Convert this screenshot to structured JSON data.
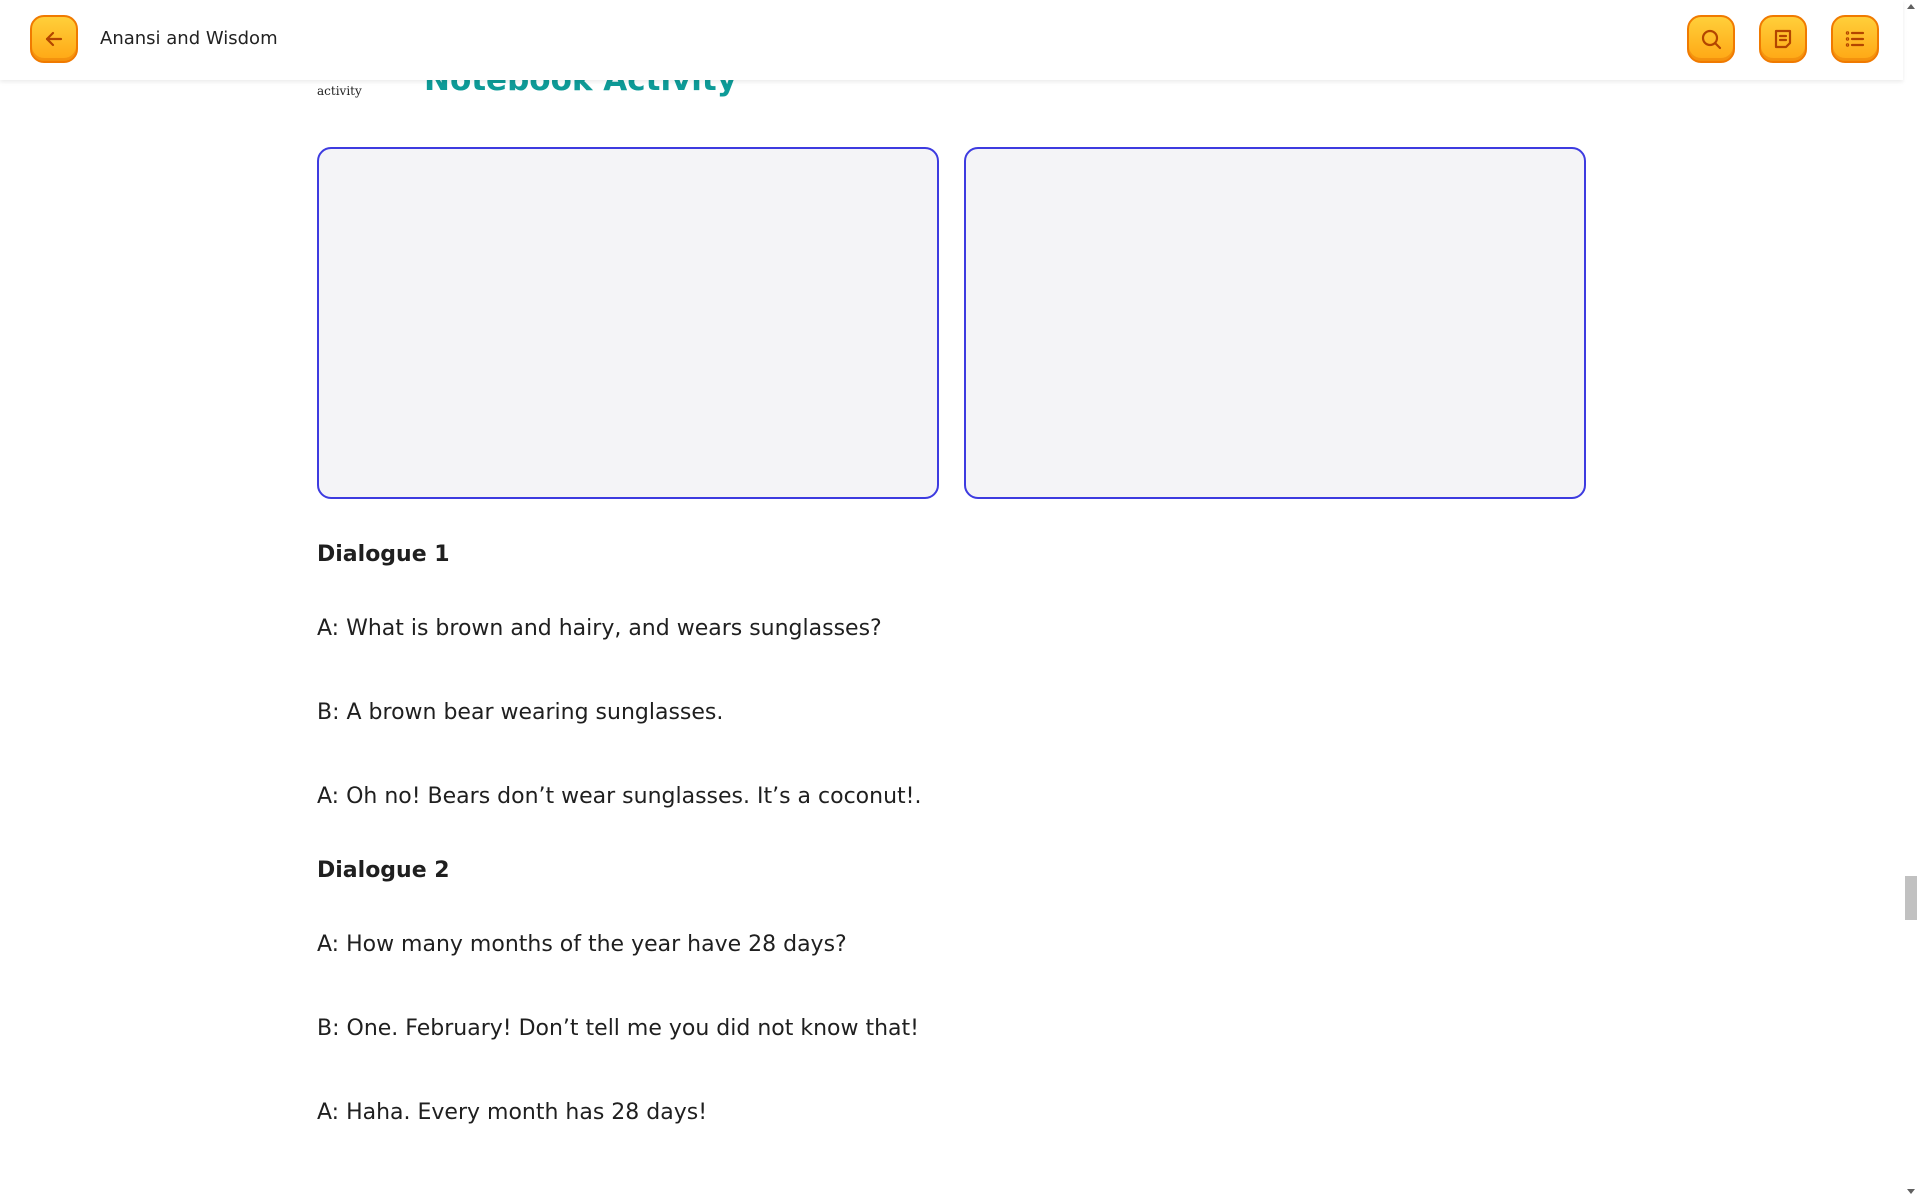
{
  "header": {
    "title": "Anansi and Wisdom",
    "back_icon": "arrow-left-icon",
    "search_icon": "search-icon",
    "notes_icon": "notes-icon",
    "toc_icon": "list-icon",
    "accent_color": "#ffb21f"
  },
  "section": {
    "small_label": "activity",
    "title": "Notebook Activity",
    "title_color": "#0e9b98"
  },
  "dialogues": [
    {
      "heading": "Dialogue 1",
      "lines": [
        "A: What is brown and hairy, and wears sunglasses?",
        "B: A brown bear wearing sunglasses.",
        "A: Oh no! Bears don’t wear sunglasses. It’s a coconut!."
      ]
    },
    {
      "heading": "Dialogue 2",
      "lines": [
        "A: How many months of the year have 28 days?",
        "B: One. February! Don’t tell me you did not know that!",
        "A: Haha. Every month has 28 days!"
      ]
    }
  ]
}
